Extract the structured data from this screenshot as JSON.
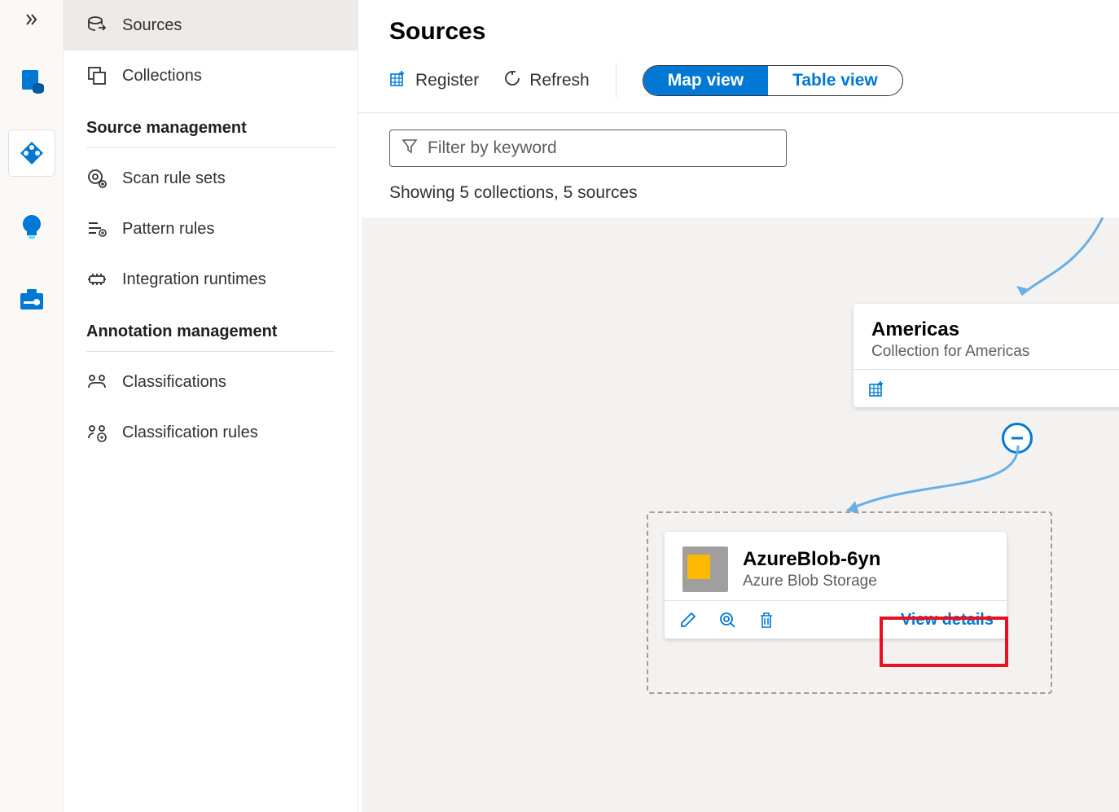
{
  "sidebar": {
    "sources": "Sources",
    "collections": "Collections",
    "section1": "Source management",
    "scan_rule_sets": "Scan rule sets",
    "pattern_rules": "Pattern rules",
    "integration_runtimes": "Integration runtimes",
    "section2": "Annotation management",
    "classifications": "Classifications",
    "classification_rules": "Classification rules"
  },
  "page": {
    "title": "Sources",
    "register": "Register",
    "refresh": "Refresh",
    "map_view": "Map view",
    "table_view": "Table view",
    "filter_placeholder": "Filter by keyword",
    "showing": "Showing 5 collections, 5 sources"
  },
  "collection_card": {
    "title": "Americas",
    "subtitle": "Collection for Americas"
  },
  "source_card": {
    "title": "AzureBlob-6yn",
    "subtitle": "Azure Blob Storage",
    "view_details": "View details"
  }
}
